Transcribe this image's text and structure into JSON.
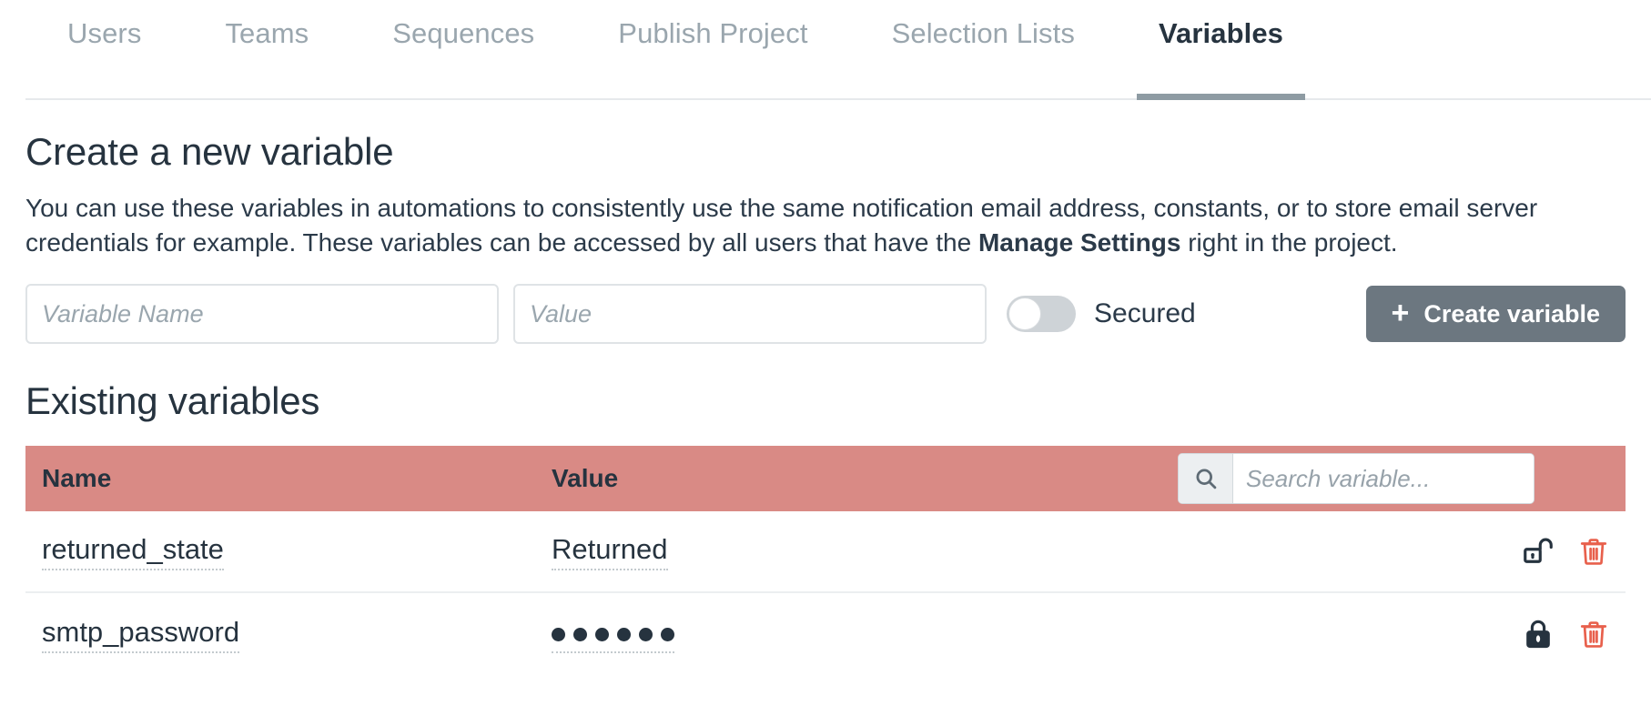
{
  "tabs": [
    {
      "label": "Users",
      "active": false
    },
    {
      "label": "Teams",
      "active": false
    },
    {
      "label": "Sequences",
      "active": false
    },
    {
      "label": "Publish Project",
      "active": false
    },
    {
      "label": "Selection Lists",
      "active": false
    },
    {
      "label": "Variables",
      "active": true
    }
  ],
  "create_section": {
    "title": "Create a new variable",
    "description_part1": "You can use these variables in automations to consistently use the same notification email address, constants, or to store email server credentials for example. These variables can be accessed by all users that have the ",
    "description_bold": "Manage Settings",
    "description_part2": " right in the project.",
    "name_placeholder": "Variable Name",
    "name_value": "",
    "value_placeholder": "Value",
    "value_value": "",
    "secured_label": "Secured",
    "secured_state": "off",
    "create_button_label": "Create variable",
    "create_button_plus": "+"
  },
  "existing_section": {
    "title": "Existing variables",
    "columns": {
      "name": "Name",
      "value": "Value"
    },
    "search_placeholder": "Search variable...",
    "search_value": "",
    "rows": [
      {
        "name": "returned_state",
        "value": "Returned",
        "masked": false,
        "lock_state": "unlocked",
        "lock_icon": "unlock-icon",
        "delete_icon": "trash-icon"
      },
      {
        "name": "smtp_password",
        "value": "••••••",
        "masked": true,
        "mask_dot_count": 6,
        "lock_state": "locked",
        "lock_icon": "lock-icon",
        "delete_icon": "trash-icon"
      }
    ]
  },
  "colors": {
    "table_header": "#d98a85",
    "button": "#6c7780",
    "text_dark": "#26333f",
    "text_muted": "#9aa6ae",
    "delete_red": "#e8604c",
    "tab_underline": "#8e9ba3"
  }
}
